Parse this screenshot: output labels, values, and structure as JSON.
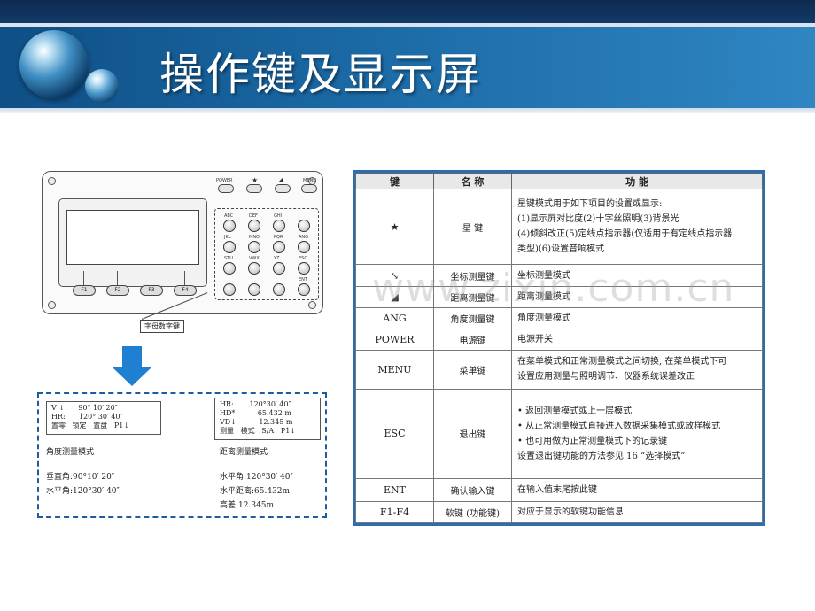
{
  "slide": {
    "title": "操作键及显示屏",
    "watermark": "www.zixin.com.cn"
  },
  "keypad": {
    "callout": "字母数字键",
    "top_labels": [
      "POWER",
      "★",
      "◢",
      "MENU"
    ],
    "fkeys": [
      "F1",
      "F2",
      "F3",
      "F4"
    ],
    "key_labels": [
      "ABC",
      "DEF",
      "GHI",
      "",
      "JKL",
      "MNO",
      "PQR",
      "ANG",
      "STU",
      "VWX",
      "YZ",
      "ESC",
      "",
      "",
      "",
      "ENT"
    ]
  },
  "display_modes": {
    "angle": {
      "screen": "V ↓      90° 10′ 20″\nHR:      120° 30′ 40″\n置零   锁定   置盘   P1↓",
      "name": "角度测量模式",
      "lines": [
        "垂直角:90°10′ 20″",
        "水平角:120°30′ 40″"
      ]
    },
    "distance": {
      "screen": "HR:       120°30′ 40″\nHD*          65.432 m\nVD↓          12.345 m\n测量   模式   S/A   P1↓",
      "name": "距离测量模式",
      "lines": [
        "水平角:120°30′ 40″",
        "水平距离:65.432m",
        "高差:12.345m"
      ]
    }
  },
  "table": {
    "headers": [
      "键",
      "名  称",
      "功          能"
    ],
    "rows": [
      {
        "key": "★",
        "name": "星  键",
        "func": [
          "星键模式用于如下项目的设置或显示:",
          "(1)显示屏对比度(2)十字丝照明(3)背景光",
          "(4)倾斜改正(5)定线点指示器(仅适用于有定线点指示器",
          "类型)(6)设置音响模式"
        ]
      },
      {
        "key": "⤡",
        "name": "坐标测量键",
        "func": [
          "坐标测量模式"
        ]
      },
      {
        "key": "◢",
        "name": "距离测量键",
        "func": [
          "距离测量模式"
        ]
      },
      {
        "key": "ANG",
        "name": "角度测量键",
        "func": [
          "角度测量模式"
        ]
      },
      {
        "key": "POWER",
        "name": "电源键",
        "func": [
          "电源开关"
        ]
      },
      {
        "key": "MENU",
        "name": "菜单键",
        "func": [
          "在菜单模式和正常测量模式之间切换, 在菜单模式下可",
          "设置应用测量与照明调节、仪器系统误差改正"
        ]
      },
      {
        "key": "ESC",
        "name": "退出键",
        "func": [
          "• 返回测量模式或上一层模式",
          "• 从正常测量模式直接进入数据采集模式或放样模式",
          "• 也可用做为正常测量模式下的记录键",
          "设置退出键功能的方法参见 16 “选择模式”"
        ]
      },
      {
        "key": "ENT",
        "name": "确认输入键",
        "func": [
          "在输入值末尾按此键"
        ]
      },
      {
        "key": "F1-F4",
        "name": "软键 (功能键)",
        "func": [
          "对应于显示的软键功能信息"
        ]
      }
    ]
  }
}
